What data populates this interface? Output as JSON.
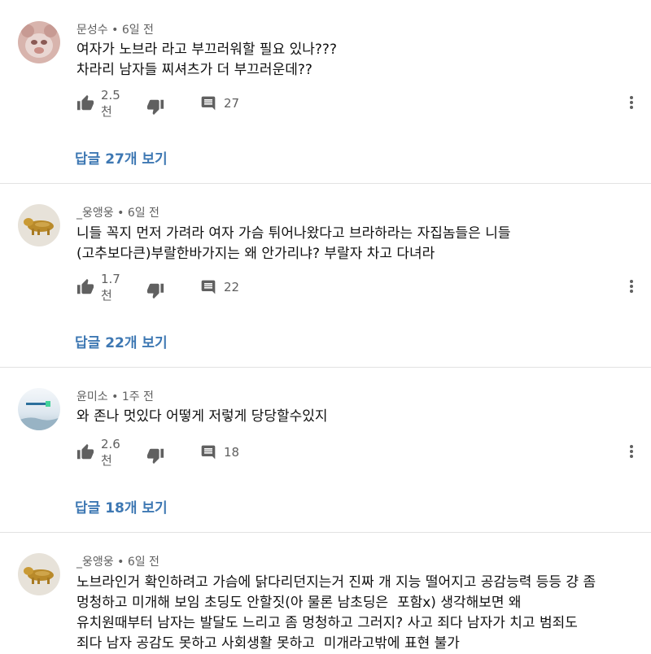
{
  "comments": [
    {
      "author": "문성수",
      "time": "6일 전",
      "lines": [
        "여자가 노브라 라고 부끄러워할 필요 있나???",
        "차라리 남자들 찌셔츠가 더 부끄러운데??"
      ],
      "likes": "2.5천",
      "reply_count": "27",
      "view_replies": "답글 27개 보기"
    },
    {
      "author": "_웅앵웅",
      "time": "6일 전",
      "lines": [
        "니들 꼭지 먼저 가려라 여자 가슴 튀어나왔다고 브라하라는 자집놈들은 니들",
        "(고추보다큰)부랄한바가지는 왜 안가리냐? 부랄자 차고 다녀라"
      ],
      "likes": "1.7천",
      "reply_count": "22",
      "view_replies": "답글 22개 보기"
    },
    {
      "author": "윤미소",
      "time": "1주 전",
      "lines": [
        "와 존나 멋있다 어떻게 저렇게 당당할수있지"
      ],
      "likes": "2.6천",
      "reply_count": "18",
      "view_replies": "답글 18개 보기"
    },
    {
      "author": "_웅앵웅",
      "time": "6일 전",
      "lines": [
        "노브라인거 확인하려고 가슴에 닭다리던지는거 진짜 개 지능 떨어지고 공감능력 등등 걍 좀",
        "멍청하고 미개해 보임 초딩도 안할짓(아 물론 남초딩은  포함x) 생각해보면 왜",
        "유치원때부터 남자는 발달도 느리고 좀 멍청하고 그러지? 사고 죄다 남자가 치고 범죄도",
        "죄다 남자 공감도 못하고 사회생활 못하고  미개라고밖에 표현 불가"
      ]
    }
  ],
  "colors": {
    "link": "#3e78b3",
    "meta": "#606060",
    "divider": "#e2e2e2"
  },
  "icons": [
    "like-icon",
    "dislike-icon",
    "reply-icon",
    "more-vert-icon"
  ]
}
